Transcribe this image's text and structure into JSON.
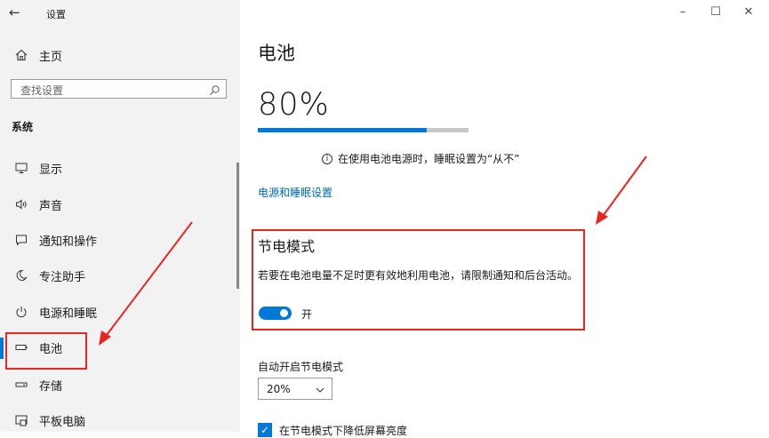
{
  "window": {
    "title": "设置",
    "back_icon": "←",
    "minimize": "–",
    "maximize": "☐",
    "close": "✕"
  },
  "sidebar": {
    "home_label": "主页",
    "search_placeholder": "查找设置",
    "section_label": "系统",
    "items": [
      {
        "name": "display",
        "label": "显示",
        "icon": "monitor-icon",
        "active": false
      },
      {
        "name": "sound",
        "label": "声音",
        "icon": "speaker-icon",
        "active": false
      },
      {
        "name": "notifications",
        "label": "通知和操作",
        "icon": "notification-icon",
        "active": false
      },
      {
        "name": "focus-assist",
        "label": "专注助手",
        "icon": "moon-icon",
        "active": false
      },
      {
        "name": "power-sleep",
        "label": "电源和睡眠",
        "icon": "power-icon",
        "active": false
      },
      {
        "name": "battery",
        "label": "电池",
        "icon": "battery-icon",
        "active": true
      },
      {
        "name": "storage",
        "label": "存储",
        "icon": "storage-icon",
        "active": false
      },
      {
        "name": "tablet",
        "label": "平板电脑",
        "icon": "tablet-icon",
        "active": false
      }
    ]
  },
  "main": {
    "title": "电池",
    "percent_text": "80%",
    "charge_level": 0.8,
    "info_text": "在使用电池电源时，睡眠设置为“从不”",
    "power_link": "电源和睡眠设置",
    "saver": {
      "title": "节电模式",
      "description": "若要在电池电量不足时更有效地利用电池，请限制通知和后台活动。",
      "toggle_state": "开",
      "toggle_on": true
    },
    "auto_label": "自动开启节电模式",
    "auto_value": "20%",
    "checkbox_label": "在节电模式下降低屏幕亮度",
    "checkbox_checked": true
  },
  "colors": {
    "accent": "#0078d7",
    "highlight": "#e8261f",
    "link": "#0067b8"
  }
}
